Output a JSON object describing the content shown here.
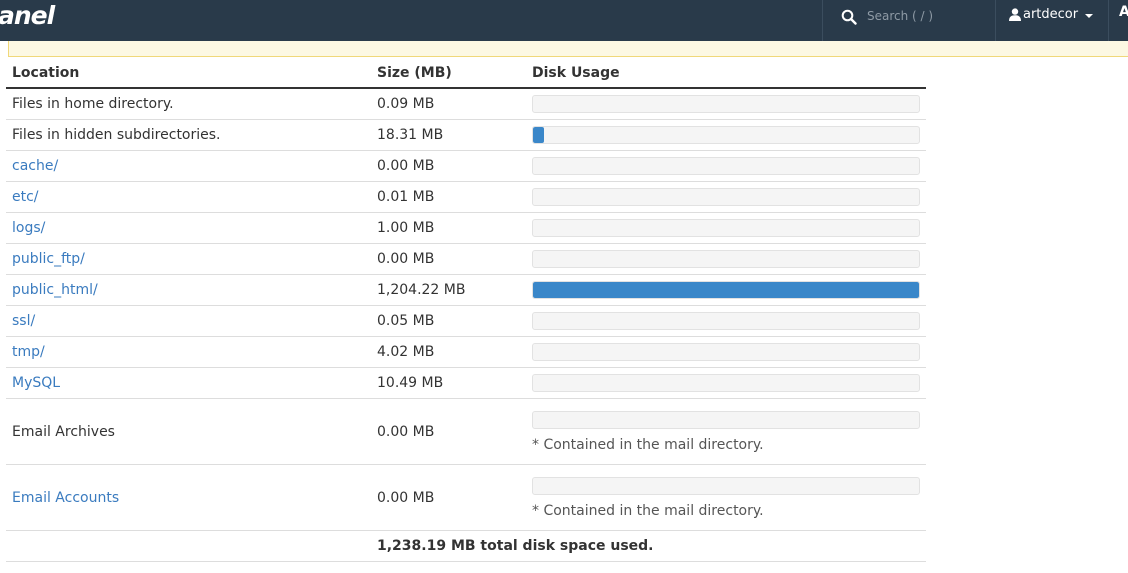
{
  "header": {
    "logo_text": "anel",
    "search_placeholder": "Search ( / )",
    "username": "artdecor",
    "edge_glyph": "A"
  },
  "colors": {
    "topbar": "#293a4a",
    "link": "#3a7bbf",
    "bar_fill": "#3a87c9",
    "notice_bg": "#fcf8e3"
  },
  "table": {
    "headers": {
      "location": "Location",
      "size": "Size (MB)",
      "usage": "Disk Usage"
    },
    "rows": [
      {
        "location": "Files in home directory.",
        "size": "0.09 MB",
        "usage_fraction": 0,
        "link": false
      },
      {
        "location": "Files in hidden subdirectories.",
        "size": "18.31 MB",
        "usage_fraction": 0.028,
        "link": false
      },
      {
        "location": "cache/",
        "size": "0.00 MB",
        "usage_fraction": 0,
        "link": true
      },
      {
        "location": "etc/",
        "size": "0.01 MB",
        "usage_fraction": 0,
        "link": true
      },
      {
        "location": "logs/",
        "size": "1.00 MB",
        "usage_fraction": 0,
        "link": true
      },
      {
        "location": "public_ftp/",
        "size": "0.00 MB",
        "usage_fraction": 0,
        "link": true
      },
      {
        "location": "public_html/",
        "size": "1,204.22 MB",
        "usage_fraction": 1.0,
        "link": true
      },
      {
        "location": "ssl/",
        "size": "0.05 MB",
        "usage_fraction": 0,
        "link": true
      },
      {
        "location": "tmp/",
        "size": "4.02 MB",
        "usage_fraction": 0,
        "link": true
      },
      {
        "location": "MySQL",
        "size": "10.49 MB",
        "usage_fraction": 0,
        "link": true
      },
      {
        "location": "Email Archives",
        "size": "0.00 MB",
        "usage_fraction": 0,
        "link": false,
        "note": "* Contained in the mail directory."
      },
      {
        "location": "Email Accounts",
        "size": "0.00 MB",
        "usage_fraction": 0,
        "link": true,
        "note": "* Contained in the mail directory."
      }
    ],
    "total": "1,238.19 MB total disk space used."
  }
}
